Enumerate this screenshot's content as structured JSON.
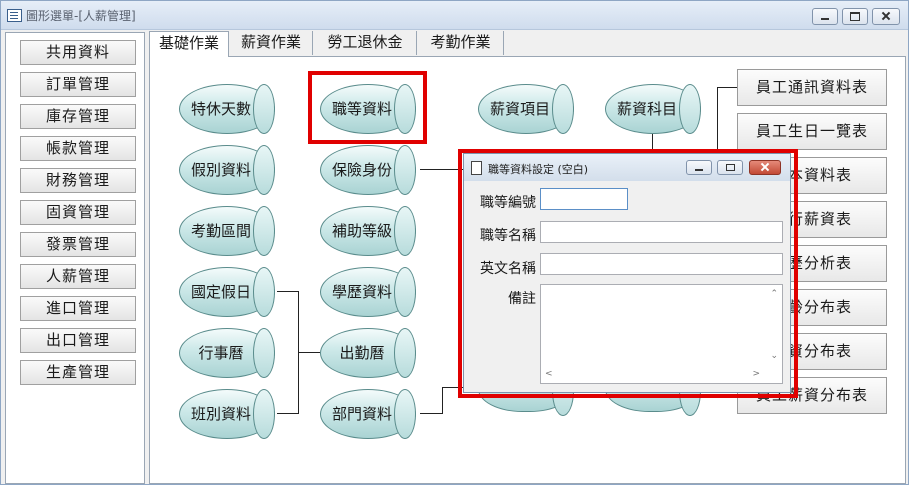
{
  "window": {
    "title": "圖形選單-[人薪管理]"
  },
  "left_menu": {
    "items": [
      {
        "label": "共用資料"
      },
      {
        "label": "訂單管理"
      },
      {
        "label": "庫存管理"
      },
      {
        "label": "帳款管理"
      },
      {
        "label": "財務管理"
      },
      {
        "label": "固資管理"
      },
      {
        "label": "發票管理"
      },
      {
        "label": "人薪管理"
      },
      {
        "label": "進口管理"
      },
      {
        "label": "出口管理"
      },
      {
        "label": "生產管理"
      }
    ]
  },
  "tabs": [
    {
      "label": "基礎作業",
      "active": true
    },
    {
      "label": "薪資作業",
      "active": false
    },
    {
      "label": "勞工退休金",
      "active": false
    },
    {
      "label": "考勤作業",
      "active": false
    }
  ],
  "flow": {
    "nodes": {
      "n0": "特休天數",
      "n1": "假別資料",
      "n2": "考勤區間",
      "n3": "國定假日",
      "n4": "行事曆",
      "n5": "班別資料",
      "n6": "職等資料",
      "n7": "保險身份",
      "n8": "補助等級",
      "n9": "學歷資料",
      "n10": "出勤曆",
      "n11": "部門資料",
      "n12": "薪資項目",
      "n13": "薪資科目"
    },
    "reports": [
      {
        "label": "員工通訊資料表"
      },
      {
        "label": "員工生日一覽表"
      },
      {
        "label": "基本資料表"
      },
      {
        "label": "現行薪資表"
      },
      {
        "label": "學歷分析表"
      },
      {
        "label": "年齡分布表"
      },
      {
        "label": "年資分布表"
      },
      {
        "label": "員工薪資分布表"
      }
    ]
  },
  "dialog": {
    "title": "職等資料設定 (空白)",
    "fields": {
      "code_label": "職等編號",
      "code_value": "",
      "name_label": "職等名稱",
      "name_value": "",
      "en_label": "英文名稱",
      "en_value": "",
      "note_label": "備註",
      "note_value": ""
    }
  },
  "colors": {
    "highlight": "#e00000",
    "node_fill": "#a9d3d3"
  }
}
